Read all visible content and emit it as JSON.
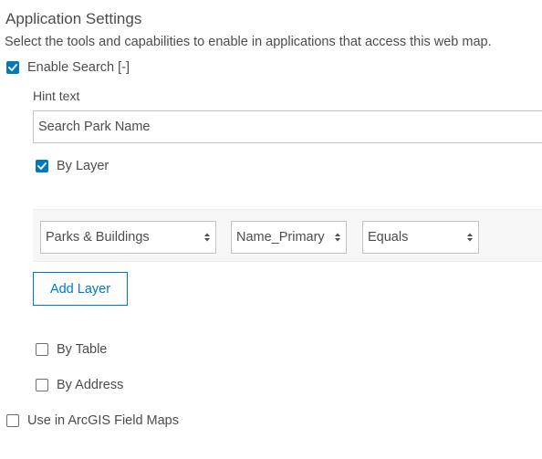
{
  "section": {
    "title": "Application Settings",
    "description": "Select the tools and capabilities to enable in applications that access this web map."
  },
  "enable_search": {
    "label": "Enable Search [-]",
    "checked": true
  },
  "hint": {
    "label": "Hint text",
    "value": "Search Park Name",
    "placeholder": ""
  },
  "by_layer": {
    "label": "By Layer",
    "checked": true,
    "row": {
      "layer": "Parks & Buildings",
      "field": "Name_Primary",
      "operator": "Equals"
    },
    "add_button": "Add Layer"
  },
  "by_table": {
    "label": "By Table",
    "checked": false
  },
  "by_address": {
    "label": "By Address",
    "checked": false
  },
  "field_maps": {
    "label": "Use in ArcGIS Field Maps",
    "checked": false
  },
  "colors": {
    "accent": "#0079c1",
    "text": "#4c4c4c",
    "border": "#c4c4c4",
    "panel": "#f7f7f7"
  }
}
